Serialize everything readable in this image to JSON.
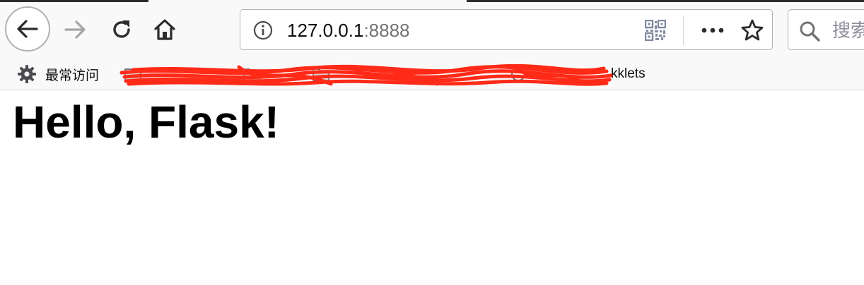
{
  "browser": {
    "url_host": "127.0.0.1",
    "url_port": ":8888",
    "search_placeholder": "搜索"
  },
  "bookmarks": {
    "most_visited_label": "最常访问",
    "items": [
      {
        "label": ""
      },
      {
        "label": ""
      },
      {
        "label": ""
      },
      {
        "label": ""
      },
      {
        "label": "kklets"
      }
    ]
  },
  "page": {
    "heading": "Hello, Flask!"
  },
  "colors": {
    "toolbar_bg": "#f9f9fa",
    "redaction": "#ff2a17"
  }
}
